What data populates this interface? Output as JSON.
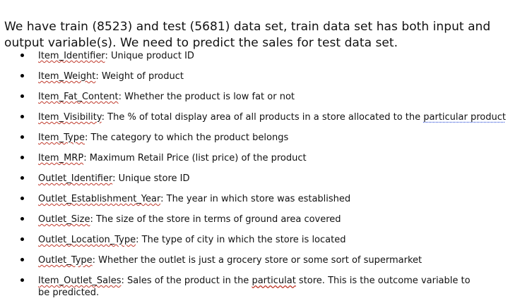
{
  "intro": {
    "text": "We have train (8523) and test (5681) data set, train data set has both input and output variable(s). We need to predict the sales for test data set."
  },
  "variables": [
    {
      "term": "Item_Identifier",
      "description": ": Unique product ID"
    },
    {
      "term": "Item_Weight",
      "description": ": Weight of product"
    },
    {
      "term": "Item_Fat_Content",
      "description": ": Whether the product is low fat or not"
    },
    {
      "term": "Item_Visibility",
      "description_pre": ": The % of total display area of all products in a store allocated to the ",
      "description_link": "particular product"
    },
    {
      "term": "Item_Type",
      "description": ": The category to which the product belongs"
    },
    {
      "term": "Item_MRP",
      "description": ": Maximum Retail Price (list price) of the product"
    },
    {
      "term": "Outlet_Identifier",
      "description": ": Unique store ID"
    },
    {
      "term": "Outlet_Establishment_Year",
      "description": ": The year in which store was established"
    },
    {
      "term": "Outlet_Size",
      "description": ": The size of the store in terms of ground area covered"
    },
    {
      "term": "Outlet_Location_Type",
      "description": ": The type of city in which the store is located"
    },
    {
      "term": "Outlet_Type",
      "description": ": Whether the outlet is just a grocery store or some sort of supermarket"
    },
    {
      "term": "Item_Outlet_Sales",
      "description_pre": ": Sales of the product in the ",
      "description_misspelled": "particulat",
      "description_post": " store. This is the outcome variable to be predicted."
    }
  ]
}
